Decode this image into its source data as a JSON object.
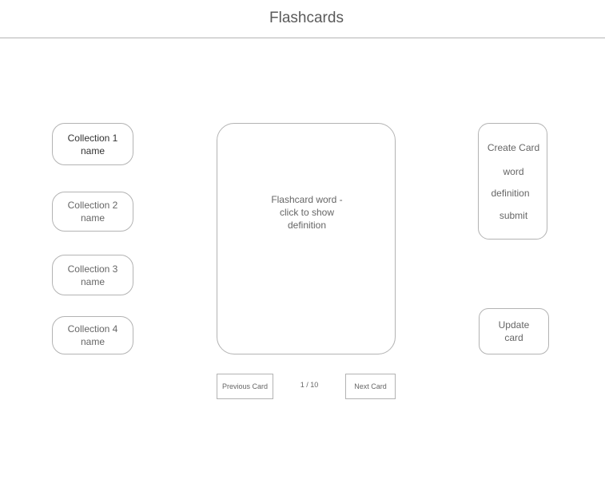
{
  "header": {
    "title": "Flashcards"
  },
  "collections": [
    {
      "label": "Collection 1\nname"
    },
    {
      "label": "Collection 2\nname"
    },
    {
      "label": "Collection 3\nname"
    },
    {
      "label": "Collection 4\nname"
    }
  ],
  "card": {
    "text": "Flashcard word -\nclick to show\ndefinition"
  },
  "pager": {
    "previous_label": "Previous Card",
    "indicator": "1 / 10",
    "next_label": "Next Card"
  },
  "create_panel": {
    "title": "Create Card",
    "word_label": "word",
    "definition_label": "definition",
    "submit_label": "submit"
  },
  "update_button": {
    "label": "Update\ncard"
  },
  "colors": {
    "border": "#b3b3b3",
    "text": "#666666",
    "background": "#ffffff"
  }
}
